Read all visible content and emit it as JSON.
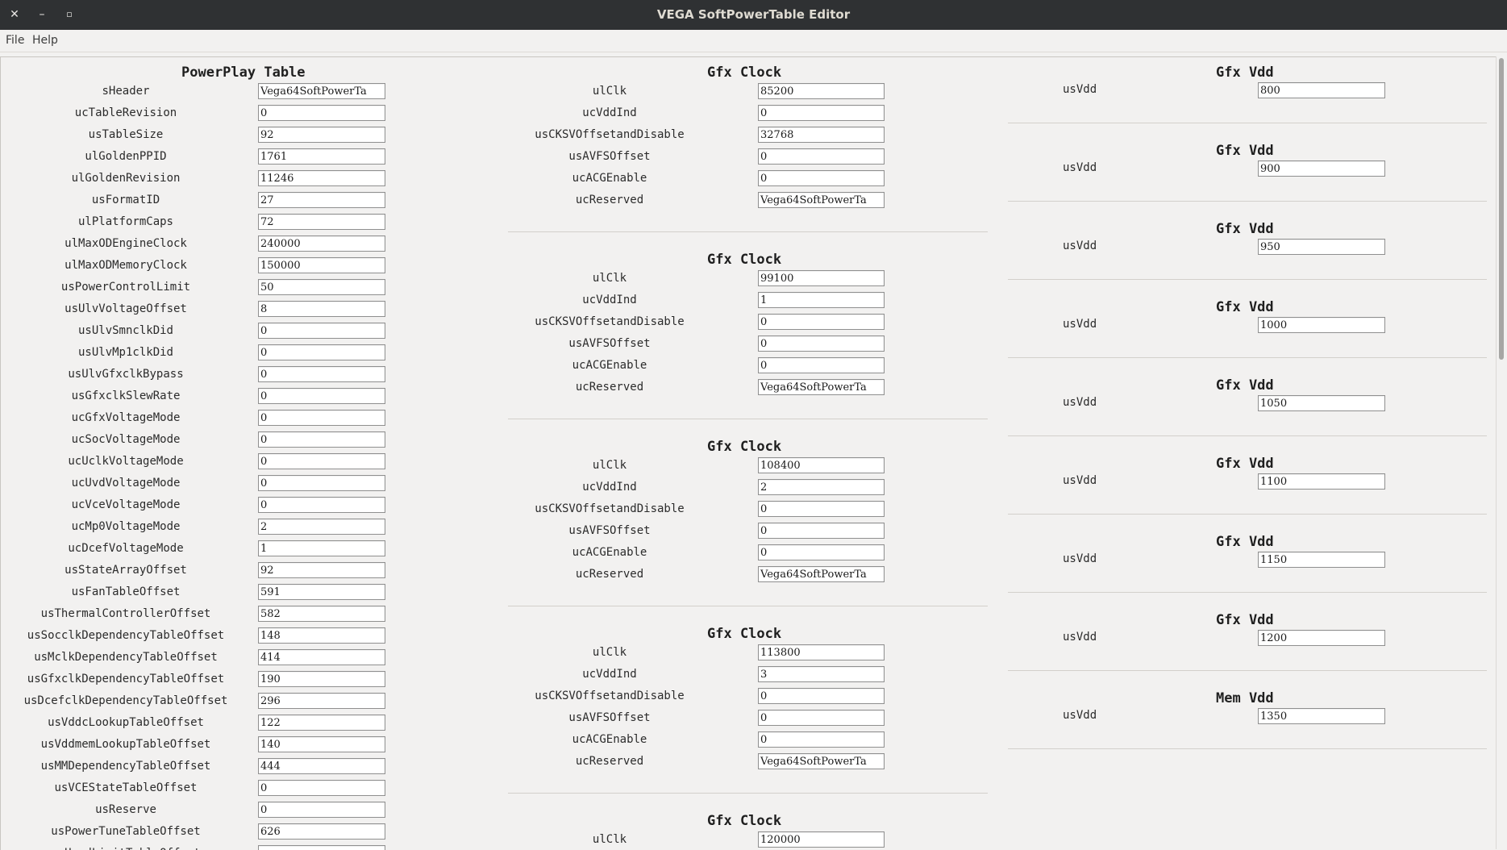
{
  "window": {
    "title": "VEGA SoftPowerTable Editor",
    "close_glyph": "✕",
    "minimize_glyph": "–",
    "maximize_glyph": "▫"
  },
  "menu": [
    "File",
    "Help"
  ],
  "powerplay": {
    "title": "PowerPlay Table",
    "fields": [
      {
        "label": "sHeader",
        "value": "Vega64SoftPowerTa"
      },
      {
        "label": "ucTableRevision",
        "value": "0"
      },
      {
        "label": "usTableSize",
        "value": "92"
      },
      {
        "label": "ulGoldenPPID",
        "value": "1761"
      },
      {
        "label": "ulGoldenRevision",
        "value": "11246"
      },
      {
        "label": "usFormatID",
        "value": "27"
      },
      {
        "label": "ulPlatformCaps",
        "value": "72"
      },
      {
        "label": "ulMaxODEngineClock",
        "value": "240000"
      },
      {
        "label": "ulMaxODMemoryClock",
        "value": "150000"
      },
      {
        "label": "usPowerControlLimit",
        "value": "50"
      },
      {
        "label": "usUlvVoltageOffset",
        "value": "8"
      },
      {
        "label": "usUlvSmnclkDid",
        "value": "0"
      },
      {
        "label": "usUlvMp1clkDid",
        "value": "0"
      },
      {
        "label": "usUlvGfxclkBypass",
        "value": "0"
      },
      {
        "label": "usGfxclkSlewRate",
        "value": "0"
      },
      {
        "label": "ucGfxVoltageMode",
        "value": "0"
      },
      {
        "label": "ucSocVoltageMode",
        "value": "0"
      },
      {
        "label": "ucUclkVoltageMode",
        "value": "0"
      },
      {
        "label": "ucUvdVoltageMode",
        "value": "0"
      },
      {
        "label": "ucVceVoltageMode",
        "value": "0"
      },
      {
        "label": "ucMp0VoltageMode",
        "value": "2"
      },
      {
        "label": "ucDcefVoltageMode",
        "value": "1"
      },
      {
        "label": "usStateArrayOffset",
        "value": "92"
      },
      {
        "label": "usFanTableOffset",
        "value": "591"
      },
      {
        "label": "usThermalControllerOffset",
        "value": "582"
      },
      {
        "label": "usSocclkDependencyTableOffset",
        "value": "148"
      },
      {
        "label": "usMclkDependencyTableOffset",
        "value": "414"
      },
      {
        "label": "usGfxclkDependencyTableOffset",
        "value": "190"
      },
      {
        "label": "usDcefclkDependencyTableOffset",
        "value": "296"
      },
      {
        "label": "usVddcLookupTableOffset",
        "value": "122"
      },
      {
        "label": "usVddmemLookupTableOffset",
        "value": "140"
      },
      {
        "label": "usMMDependencyTableOffset",
        "value": "444"
      },
      {
        "label": "usVCEStateTableOffset",
        "value": "0"
      },
      {
        "label": "usReserve",
        "value": "0"
      },
      {
        "label": "usPowerTuneTableOffset",
        "value": "626"
      },
      {
        "label": "usHardLimitTableOffset",
        "value": ""
      }
    ]
  },
  "gfx_clocks": [
    {
      "title": "Gfx Clock",
      "fields": [
        {
          "label": "ulClk",
          "value": "85200"
        },
        {
          "label": "ucVddInd",
          "value": "0"
        },
        {
          "label": "usCKSVOffsetandDisable",
          "value": "32768"
        },
        {
          "label": "usAVFSOffset",
          "value": "0"
        },
        {
          "label": "ucACGEnable",
          "value": "0"
        },
        {
          "label": "ucReserved",
          "value": "Vega64SoftPowerTa"
        }
      ]
    },
    {
      "title": "Gfx Clock",
      "fields": [
        {
          "label": "ulClk",
          "value": "99100"
        },
        {
          "label": "ucVddInd",
          "value": "1"
        },
        {
          "label": "usCKSVOffsetandDisable",
          "value": "0"
        },
        {
          "label": "usAVFSOffset",
          "value": "0"
        },
        {
          "label": "ucACGEnable",
          "value": "0"
        },
        {
          "label": "ucReserved",
          "value": "Vega64SoftPowerTa"
        }
      ]
    },
    {
      "title": "Gfx Clock",
      "fields": [
        {
          "label": "ulClk",
          "value": "108400"
        },
        {
          "label": "ucVddInd",
          "value": "2"
        },
        {
          "label": "usCKSVOffsetandDisable",
          "value": "0"
        },
        {
          "label": "usAVFSOffset",
          "value": "0"
        },
        {
          "label": "ucACGEnable",
          "value": "0"
        },
        {
          "label": "ucReserved",
          "value": "Vega64SoftPowerTa"
        }
      ]
    },
    {
      "title": "Gfx Clock",
      "fields": [
        {
          "label": "ulClk",
          "value": "113800"
        },
        {
          "label": "ucVddInd",
          "value": "3"
        },
        {
          "label": "usCKSVOffsetandDisable",
          "value": "0"
        },
        {
          "label": "usAVFSOffset",
          "value": "0"
        },
        {
          "label": "ucACGEnable",
          "value": "0"
        },
        {
          "label": "ucReserved",
          "value": "Vega64SoftPowerTa"
        }
      ]
    },
    {
      "title": "Gfx Clock",
      "fields": [
        {
          "label": "ulClk",
          "value": "120000"
        }
      ]
    }
  ],
  "vdds": [
    {
      "title": "Gfx Vdd",
      "label": "usVdd",
      "value": "800"
    },
    {
      "title": "Gfx Vdd",
      "label": "usVdd",
      "value": "900"
    },
    {
      "title": "Gfx Vdd",
      "label": "usVdd",
      "value": "950"
    },
    {
      "title": "Gfx Vdd",
      "label": "usVdd",
      "value": "1000"
    },
    {
      "title": "Gfx Vdd",
      "label": "usVdd",
      "value": "1050"
    },
    {
      "title": "Gfx Vdd",
      "label": "usVdd",
      "value": "1100"
    },
    {
      "title": "Gfx Vdd",
      "label": "usVdd",
      "value": "1150"
    },
    {
      "title": "Gfx Vdd",
      "label": "usVdd",
      "value": "1200"
    },
    {
      "title": "Mem Vdd",
      "label": "usVdd",
      "value": "1350"
    }
  ]
}
